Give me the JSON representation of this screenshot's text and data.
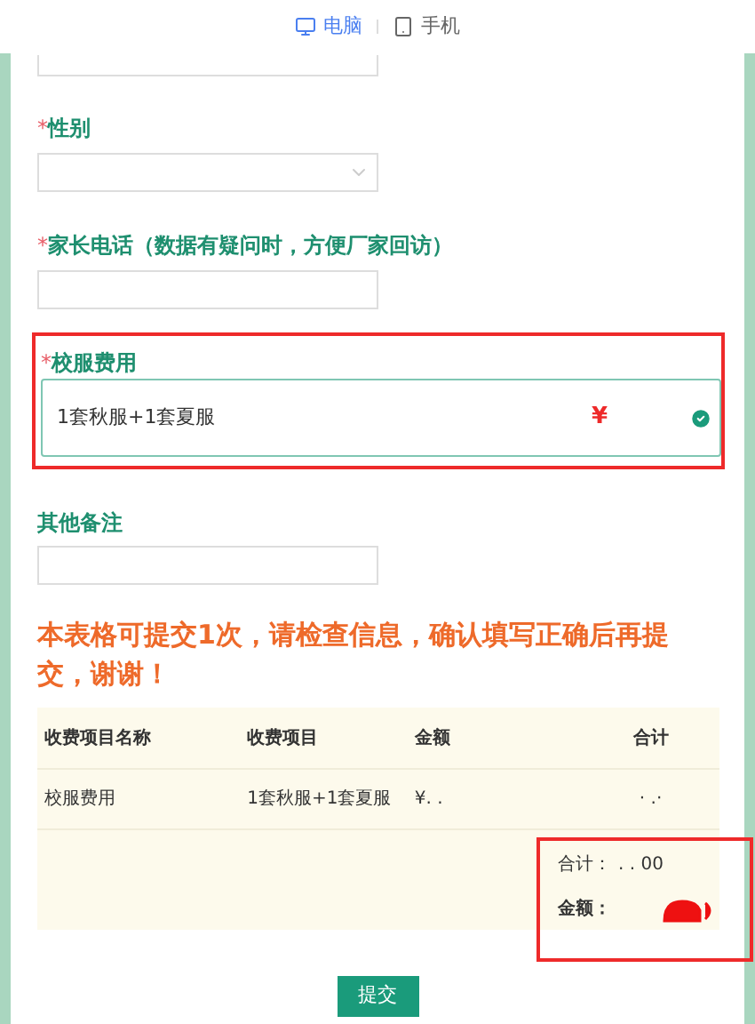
{
  "view_tabs": [
    {
      "label": "电脑",
      "kind": "desktop",
      "selected": true
    },
    {
      "label": "手机",
      "kind": "mobile",
      "selected": false
    }
  ],
  "fields": [
    {
      "kind": "partial"
    },
    {
      "kind": "select",
      "label": "性别",
      "required_mark": "*"
    },
    {
      "kind": "text",
      "label": "家长电话（数据有疑问时，方便厂家回访）",
      "required_mark": "*"
    },
    {
      "kind": "option",
      "label": "校服费用",
      "required_mark": "*",
      "highlighted": true,
      "option": {
        "name": "1套秋服+1套夏服",
        "price": "¥",
        "checked": true
      }
    },
    {
      "kind": "text",
      "label": "其他备注"
    }
  ],
  "notice": "本表格可提交1次，请检查信息，确认填写正确后再提交，谢谢！",
  "fee_table": {
    "columns": [
      "收费项目名称",
      "收费项目",
      "金额",
      "合计"
    ],
    "rows": [
      [
        "校服费用",
        "1套秋服+1套夏服",
        "¥. .",
        "· .·"
      ]
    ],
    "summary": {
      "highlighted": true,
      "total_label": "合计：",
      "total_value": ". . 00",
      "amount_label": "金额："
    }
  },
  "submit_button": "提交"
}
